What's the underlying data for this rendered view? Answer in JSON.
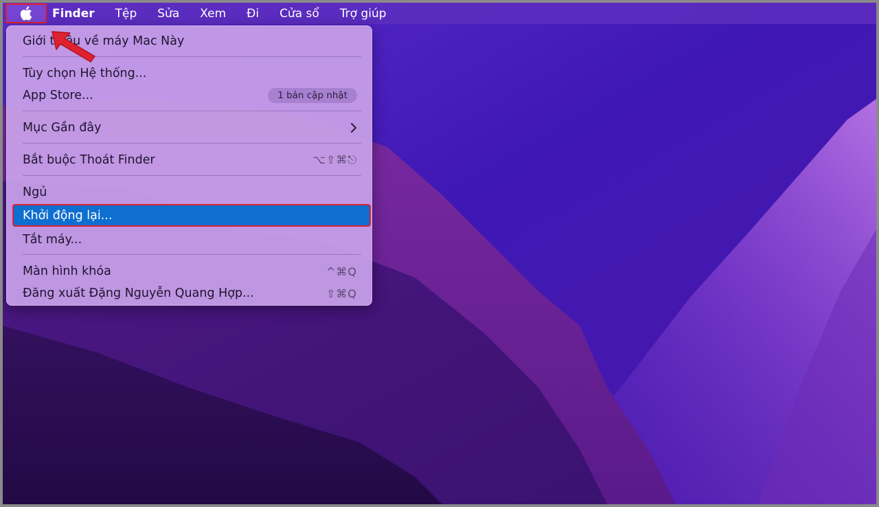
{
  "menubar": {
    "apple_icon": "apple-logo-icon",
    "items": [
      "Finder",
      "Tệp",
      "Sửa",
      "Xem",
      "Đi",
      "Cửa sổ",
      "Trợ giúp"
    ]
  },
  "apple_menu": {
    "about": "Giới thiệu về máy Mac Này",
    "system_prefs": "Tùy chọn Hệ thống...",
    "app_store": "App Store...",
    "app_store_badge": "1 bản cập nhật",
    "recent_items": "Mục Gần đây",
    "force_quit": "Bắt buộc Thoát Finder",
    "force_quit_shortcut": "⌥⇧⌘⎋",
    "sleep": "Ngủ",
    "restart": "Khởi động lại...",
    "shutdown": "Tắt máy...",
    "lock_screen": "Màn hình khóa",
    "lock_screen_shortcut": "^⌘Q",
    "logout": "Đăng xuất Đặng Nguyễn Quang Hợp...",
    "logout_shortcut": "⇧⌘Q"
  },
  "colors": {
    "highlight": "#0f6fd0",
    "annotation_red": "#e0212f"
  }
}
